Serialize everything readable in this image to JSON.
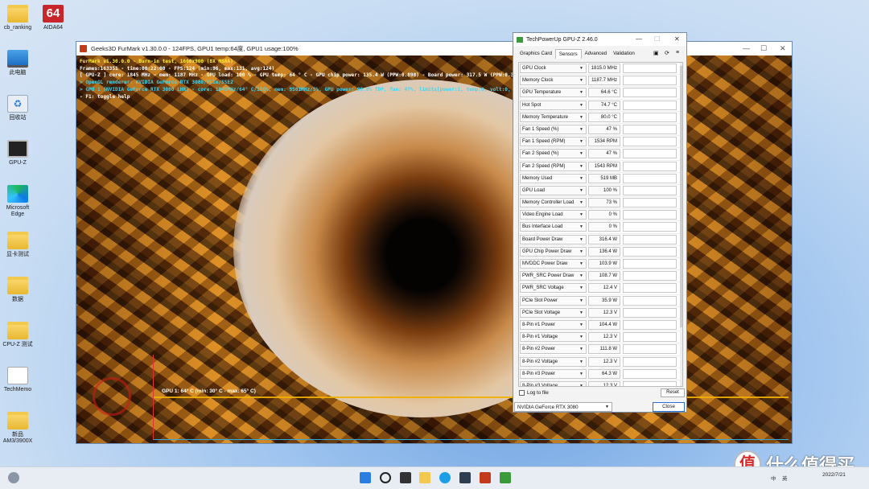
{
  "desktop_icons": [
    {
      "label": "cb_ranking",
      "icon": "folder-icon"
    },
    {
      "label": "AIDA64",
      "icon": "aida64-icon",
      "glyph": "64"
    },
    {
      "label": "此电脑",
      "icon": "computer-icon"
    },
    {
      "label": "回收站",
      "icon": "recycle-bin-icon",
      "glyph": "♻"
    },
    {
      "label": "GPU-Z",
      "icon": "gpuz-icon"
    },
    {
      "label": "Microsoft Edge",
      "icon": "edge-icon"
    },
    {
      "label": "显卡测试",
      "icon": "folder-icon"
    },
    {
      "label": "数据",
      "icon": "folder-icon"
    },
    {
      "label": "CPU-Z 测试",
      "icon": "folder-icon"
    },
    {
      "label": "TechMemo",
      "icon": "text-file-icon"
    },
    {
      "label": "新品 AM3/3900X",
      "icon": "folder-icon"
    }
  ],
  "furmark": {
    "title": "Geeks3D FurMark v1.30.0.0 - 124FPS, GPU1 temp:64度, GPU1 usage:100%",
    "overlay": [
      {
        "text": "FurMark v1.30.0.0 - Burn-in test, 1600x900 (8X MSAA)",
        "color": "y"
      },
      {
        "text": "Frames:163351 - time:00:22:00 - FPS:124 (min:96, max:131, avg:124)",
        "color": "w"
      },
      {
        "text": "[ GPU-Z ] core: 1845 MHz - mem: 1187 MHz - GPU load: 100 % - GPU temp: 64 ° C - GPU chip power: 135.4 W (PPW:0.898) - Board power: 317.5 W (PPW:0.391) - GPU voltage: 0.988 V",
        "color": "w"
      },
      {
        "text": "> OpenGL renderer: NVIDIA GeForce RTX 3080/PCIe/SSE2",
        "color": "c"
      },
      {
        "text": "> GPU 1 (NVIDIA GeForce RTX 3080 LHR) - core: 1845MHz/64° C/100%, mem: 9501MHz/5%, GPU power: 99.8% TDP, fan: 47%, limits[power:1, temp:0, volt:0, OV:0]",
        "color": "c"
      },
      {
        "text": "- F1: toggle help",
        "color": "w"
      }
    ],
    "graph_label": "GPU 1: 64° C (min: 30° C - max: 65° C)"
  },
  "gpuz": {
    "title": "TechPowerUp GPU-Z 2.46.0",
    "tabs": [
      "Graphics Card",
      "Sensors",
      "Advanced",
      "Validation"
    ],
    "active_tab": "Sensors",
    "sensors": [
      {
        "name": "GPU Clock",
        "value": "1815.0 MHz",
        "level": 0.85
      },
      {
        "name": "Memory Clock",
        "value": "1187.7 MHz",
        "level": 0.85
      },
      {
        "name": "GPU Temperature",
        "value": "64.6 °C",
        "level": 0.6
      },
      {
        "name": "Hot Spot",
        "value": "74.7 °C",
        "level": 0.6
      },
      {
        "name": "Memory Temperature",
        "value": "80.0 °C",
        "level": 0.6
      },
      {
        "name": "Fan 1 Speed (%)",
        "value": "47 %",
        "level": 0.45
      },
      {
        "name": "Fan 1 Speed (RPM)",
        "value": "1534 RPM",
        "level": 0.2
      },
      {
        "name": "Fan 2 Speed (%)",
        "value": "47 %",
        "level": 0.45
      },
      {
        "name": "Fan 2 Speed (RPM)",
        "value": "1543 RPM",
        "level": 0.2
      },
      {
        "name": "Memory Used",
        "value": "519 MB",
        "level": 0.1
      },
      {
        "name": "GPU Load",
        "value": "100 %",
        "level": 1.0
      },
      {
        "name": "Memory Controller Load",
        "value": "73 %",
        "level": 0.75
      },
      {
        "name": "Video Engine Load",
        "value": "0 %",
        "level": 0.0
      },
      {
        "name": "Bus Interface Load",
        "value": "0 %",
        "level": 0.0
      },
      {
        "name": "Board Power Draw",
        "value": "316.4 W",
        "level": 0.85
      },
      {
        "name": "GPU Chip Power Draw",
        "value": "136.4 W",
        "level": 0.85
      },
      {
        "name": "MVDDC Power Draw",
        "value": "103.9 W",
        "level": 0.85
      },
      {
        "name": "PWR_SRC Power Draw",
        "value": "108.7 W",
        "level": 0.85
      },
      {
        "name": "PWR_SRC Voltage",
        "value": "12.4 V",
        "level": 0.85
      },
      {
        "name": "PCIe Slot Power",
        "value": "35.9 W",
        "level": 0.6
      },
      {
        "name": "PCIe Slot Voltage",
        "value": "12.3 V",
        "level": 0.85
      },
      {
        "name": "8-Pin #1 Power",
        "value": "104.4 W",
        "level": 0.85
      },
      {
        "name": "8-Pin #1 Voltage",
        "value": "12.3 V",
        "level": 0.85
      },
      {
        "name": "8-Pin #2 Power",
        "value": "111.8 W",
        "level": 0.85
      },
      {
        "name": "8-Pin #2 Voltage",
        "value": "12.3 V",
        "level": 0.85
      },
      {
        "name": "8-Pin #3 Power",
        "value": "64.3 W",
        "level": 0.75
      },
      {
        "name": "8-Pin #3 Voltage",
        "value": "12.3 V",
        "level": 0.85
      }
    ],
    "log_label": "Log to file",
    "reset_label": "Reset",
    "gpu_selected": "NVIDIA GeForce RTX 3080",
    "close_label": "Close"
  },
  "taskbar": {
    "tray_lang": "中",
    "tray_ime": "英",
    "clock_date": "2022/7/21"
  },
  "watermark": {
    "badge": "值",
    "text": "什么值得买"
  }
}
